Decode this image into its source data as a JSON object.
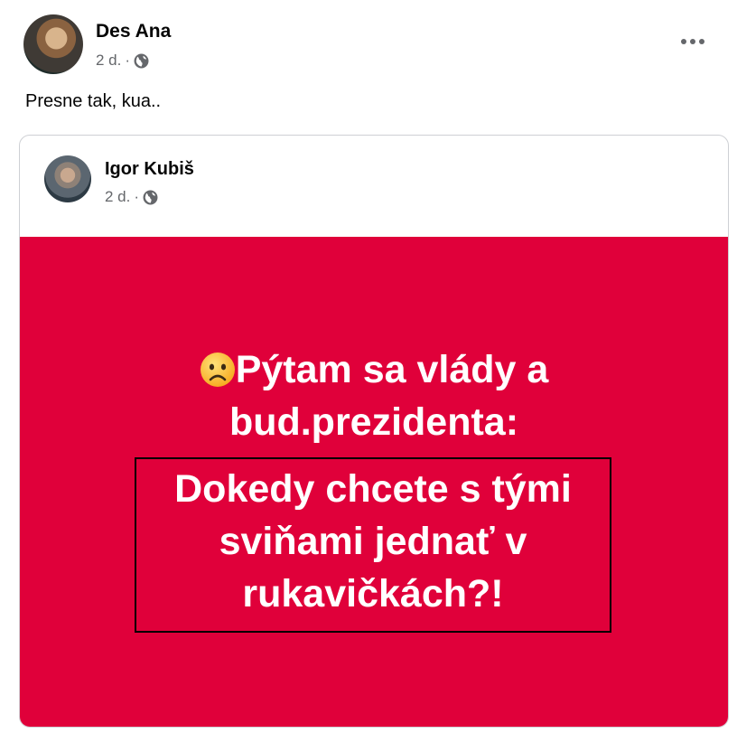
{
  "post": {
    "author": "Des Ana",
    "time": "2 d.",
    "text": "Presne tak, kua..",
    "privacy_icon": "globe-icon",
    "more_icon": "more-options-icon"
  },
  "shared_post": {
    "author": "Igor Kubiš",
    "time": "2 d.",
    "privacy_icon": "globe-icon",
    "background_color": "#e0003a",
    "emoji": "frowning-face-emoji",
    "headline_line1": "Pýtam sa vlády a",
    "headline_line2": "bud.prezidenta:",
    "boxed_line1": "Dokedy chcete s tými",
    "boxed_line2": "sviňami jednať v",
    "boxed_line3": "rukavičkách?!"
  }
}
